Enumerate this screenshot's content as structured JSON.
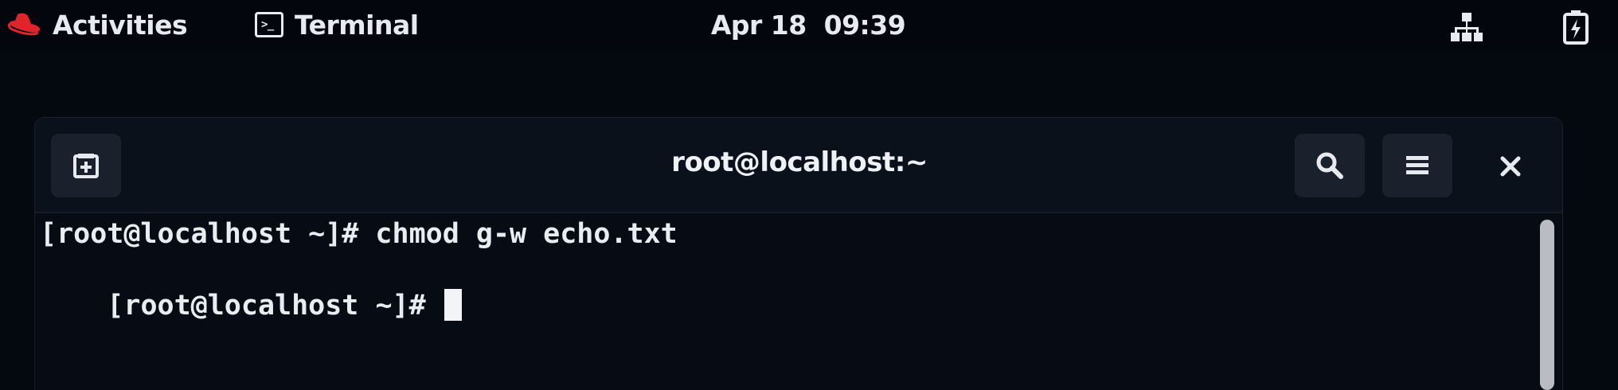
{
  "topbar": {
    "activities_label": "Activities",
    "app_menu_label": "Terminal",
    "clock": "Apr 18  09:39",
    "icons": {
      "logo": "redhat-logo-icon",
      "app": "terminal-icon",
      "network": "wired-network-icon",
      "battery": "battery-icon"
    }
  },
  "window": {
    "title": "root@localhost:~",
    "buttons": {
      "new_tab": "new-tab-icon",
      "search": "search-icon",
      "menu": "hamburger-menu-icon",
      "close": "close-icon"
    }
  },
  "terminal": {
    "lines": [
      "[root@localhost ~]# chmod g-w echo.txt",
      "[root@localhost ~]# "
    ]
  },
  "colors": {
    "background": "#040910",
    "text": "#e9ecf1",
    "redhat_red": "#e0242b"
  }
}
